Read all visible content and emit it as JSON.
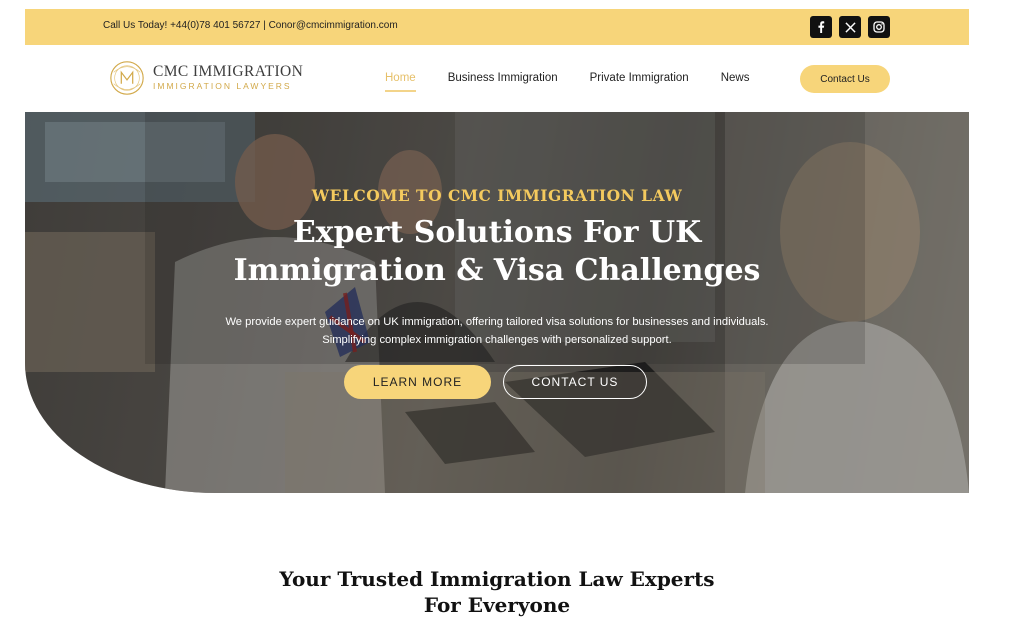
{
  "topbar": {
    "contact_text": "Call Us Today! +44(0)78 401 56727 | Conor@cmcimmigration.com",
    "socials": [
      {
        "icon": "facebook-icon"
      },
      {
        "icon": "x-twitter-icon"
      },
      {
        "icon": "instagram-icon"
      }
    ]
  },
  "header": {
    "logo_title": "CMC IMMIGRATION",
    "logo_subtitle": "IMMIGRATION LAWYERS",
    "nav": [
      {
        "label": "Home",
        "active": true
      },
      {
        "label": "Business Immigration",
        "active": false
      },
      {
        "label": "Private Immigration",
        "active": false
      },
      {
        "label": "News",
        "active": false
      }
    ],
    "cta_label": "Contact Us"
  },
  "hero": {
    "kicker": "WELCOME TO CMC IMMIGRATION LAW",
    "title_line1": "Expert Solutions For UK",
    "title_line2": "Immigration & Visa Challenges",
    "description": "We provide expert guidance on UK immigration, offering tailored visa solutions for businesses and individuals. Simplifying complex immigration challenges with personalized support.",
    "learn_more_label": "LEARN MORE",
    "contact_label": "CONTACT US"
  },
  "section": {
    "title_line1": "Your Trusted Immigration Law Experts",
    "title_line2": "For Everyone"
  },
  "colors": {
    "accent_yellow": "#f7d57a",
    "kicker_gold": "#f4ca5e",
    "logo_gold": "#d2a94a",
    "active_nav": "#e6c06a"
  }
}
